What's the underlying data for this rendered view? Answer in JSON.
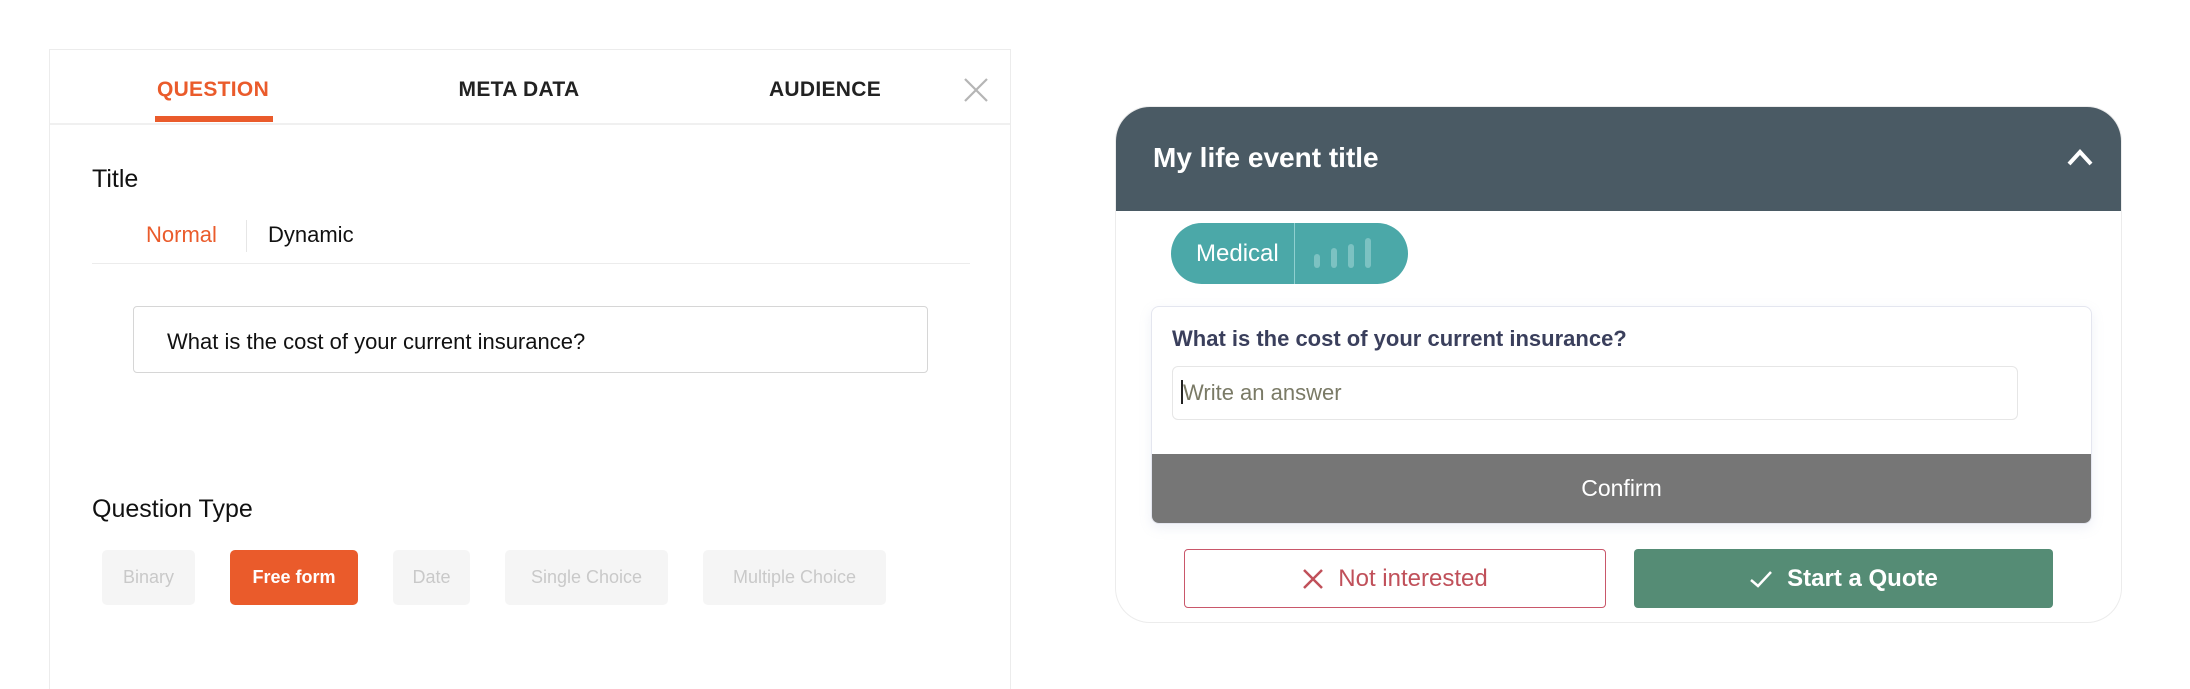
{
  "editor": {
    "tabs": [
      {
        "label": "QUESTION",
        "active": true
      },
      {
        "label": "META DATA",
        "active": false
      },
      {
        "label": "AUDIENCE",
        "active": false
      }
    ],
    "close_icon": "close-icon",
    "title_label": "Title",
    "title_modes": [
      "Normal",
      "Dynamic"
    ],
    "title_mode_selected": "Normal",
    "title_value": "What is the cost of your current insurance?",
    "question_type_label": "Question Type",
    "question_types": [
      "Binary",
      "Free form",
      "Date",
      "Single Choice",
      "Multiple Choice"
    ],
    "question_type_selected": "Free form",
    "accent": "#ea5b2b"
  },
  "preview": {
    "title": "My life event title",
    "collapse_icon": "chevron-up-icon",
    "category": "Medical",
    "category_icon": "signal-bars-icon",
    "question": "What is the cost of your current insurance?",
    "answer_placeholder": "Write an answer",
    "confirm_label": "Confirm",
    "not_interested_label": "Not interested",
    "start_quote_label": "Start a Quote",
    "colors": {
      "header": "#4a5a64",
      "pill": "#4ba8a8",
      "confirm": "#767676",
      "decline": "#c0505a",
      "accept": "#558c75"
    }
  }
}
